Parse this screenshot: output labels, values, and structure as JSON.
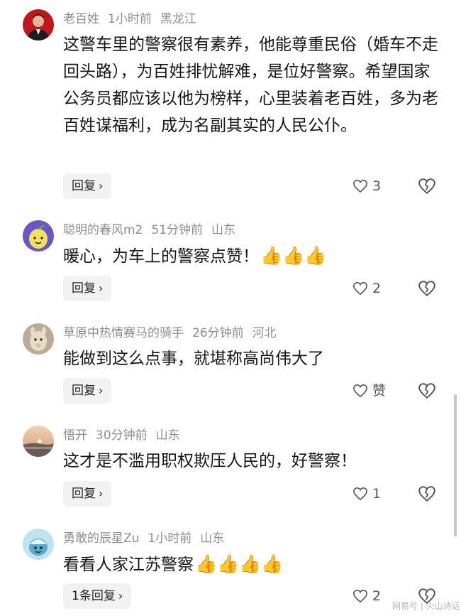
{
  "comments": [
    {
      "user": "老百姓",
      "time": "1小时前",
      "location": "黑龙江",
      "text": "这警车里的警察很有素养，他能尊重民俗（婚车不走回头路），为百姓排忧解难，是位好警察。希望国家公务员都应该以他为榜样，心里装着老百姓，多为老百姓谋福利，成为名副其实的人民公仆。",
      "reply_label": "回复",
      "like_count": "3",
      "avatar_icon": "man-portrait-icon"
    },
    {
      "user": "聪明的春风m2",
      "time": "51分钟前",
      "location": "山东",
      "text": "暖心，为车上的警察点赞！",
      "emoji": "👍👍👍",
      "reply_label": "回复",
      "like_count": "2",
      "avatar_icon": "cartoon-lemon-icon"
    },
    {
      "user": "草原中热情赛马的骑手",
      "time": "26分钟前",
      "location": "河北",
      "text": "能做到这么点事，就堪称高尚伟大了",
      "reply_label": "回复",
      "like_count": "赞",
      "avatar_icon": "alpaca-icon"
    },
    {
      "user": "悟开",
      "time": "30分钟前",
      "location": "山东",
      "text": "这才是不滥用职权欺压人民的，好警察！",
      "reply_label": "回复",
      "like_count": "1",
      "avatar_icon": "sunset-landscape-icon"
    },
    {
      "user": "勇敢的辰星Zu",
      "time": "1小时前",
      "location": "山东",
      "text": "看看人家江苏警察",
      "emoji": "👍👍👍👍",
      "reply_label": "1条回复",
      "like_count": "2",
      "avatar_icon": "cartoon-character-icon"
    }
  ],
  "watermark": "网易号 | 火山诗话",
  "colors": {
    "meta": "#8d8d8d",
    "text": "#161616",
    "reply_bg": "#f2f2f2"
  }
}
